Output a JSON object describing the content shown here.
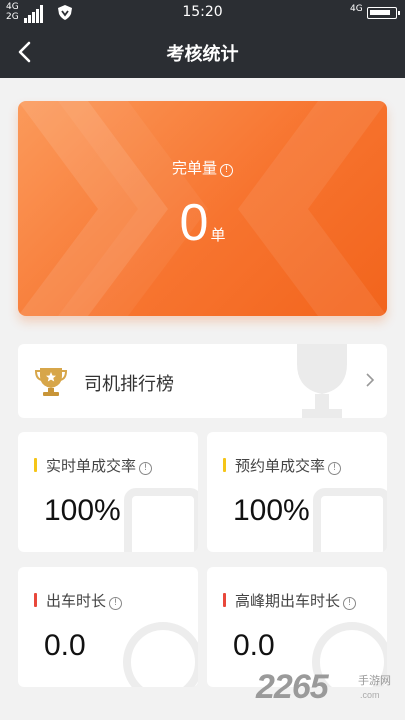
{
  "status_bar": {
    "net_top": "4G",
    "net_bottom": "2G",
    "time": "15:20",
    "net_right": "4G",
    "icons": [
      "signal-icon",
      "shield-icon",
      "battery-icon"
    ]
  },
  "nav": {
    "title": "考核统计",
    "back_icon": "chevron-left-icon"
  },
  "summary": {
    "label": "完单量",
    "info_glyph": "!",
    "value": "0",
    "unit": "单"
  },
  "ranking": {
    "label": "司机排行榜",
    "icon": "trophy-icon",
    "chevron": "chevron-right-icon"
  },
  "metrics": [
    {
      "label": "实时单成交率",
      "value": "100%",
      "bar_color": "#f5c518"
    },
    {
      "label": "预约单成交率",
      "value": "100%",
      "bar_color": "#f5c518"
    },
    {
      "label": "出车时长",
      "value": "0.0",
      "bar_color": "#e8483b"
    },
    {
      "label": "高峰期出车时长",
      "value": "0.0",
      "bar_color": "#e8483b"
    }
  ],
  "watermark": {
    "brand": "2265",
    "suffix": "手游网",
    "domain": ".com"
  },
  "colors": {
    "header": "#2b2e33",
    "accent": "#f7742f",
    "background": "#f2f2f2"
  }
}
